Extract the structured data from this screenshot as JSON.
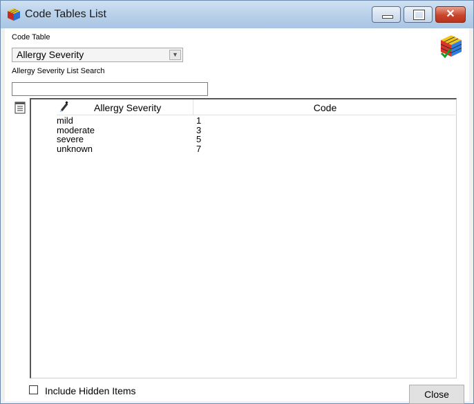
{
  "window": {
    "title": "Code Tables List",
    "title_bar_color": "#b9d1ea"
  },
  "code_table": {
    "label": "Code Table",
    "selected_value": "Allergy Severity"
  },
  "search": {
    "label": "Allergy Severity List Search",
    "value": ""
  },
  "grid": {
    "columns": [
      "Allergy Severity",
      "Code"
    ],
    "rows": [
      {
        "name": "mild",
        "code": "1"
      },
      {
        "name": "moderate",
        "code": "3"
      },
      {
        "name": "severe",
        "code": "5"
      },
      {
        "name": "unknown",
        "code": "7"
      }
    ]
  },
  "options": {
    "include_hidden_label": "Include Hidden Items",
    "include_hidden_checked": false
  },
  "buttons": {
    "close_label": "Close"
  },
  "icons": {
    "app": "rubik-cube-icon",
    "cube": "rubik-cube-check-icon",
    "list": "list-report-icon",
    "pen": "pen-icon"
  }
}
